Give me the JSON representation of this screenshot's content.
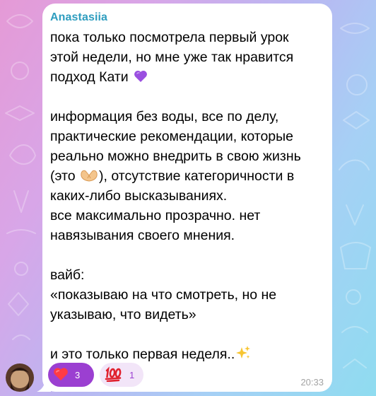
{
  "message": {
    "sender": "Anastasiia",
    "lines": [
      "пока только посмотрела первый урок",
      "этой недели, но мне уже так нравится",
      "подход Кати",
      "",
      "информация без воды, все по делу,",
      "практические рекомендации, которые",
      "реально можно внедрить в свою жизнь",
      "(это",
      "), отсутствие категоричности в",
      "каких-либо высказываниях.",
      "все максимально прозрачно. нет",
      "навязывания своего мнения.",
      "",
      "вайб:",
      "«показываю на что смотреть, но не",
      "указываю, что видеть»",
      "",
      "и это только первая неделя.."
    ],
    "time": "20:33"
  },
  "reactions": [
    {
      "emoji": "heart-icon",
      "count": "3",
      "chosen": true
    },
    {
      "emoji": "hundred-points-icon",
      "count": "1",
      "chosen": false
    }
  ],
  "colors": {
    "sender_name": "#2e9dbf",
    "reaction_active": "#9b3fd1",
    "reaction_inactive_bg": "#f2e5f8",
    "bubble": "#ffffff",
    "time": "#a3a3a3"
  }
}
